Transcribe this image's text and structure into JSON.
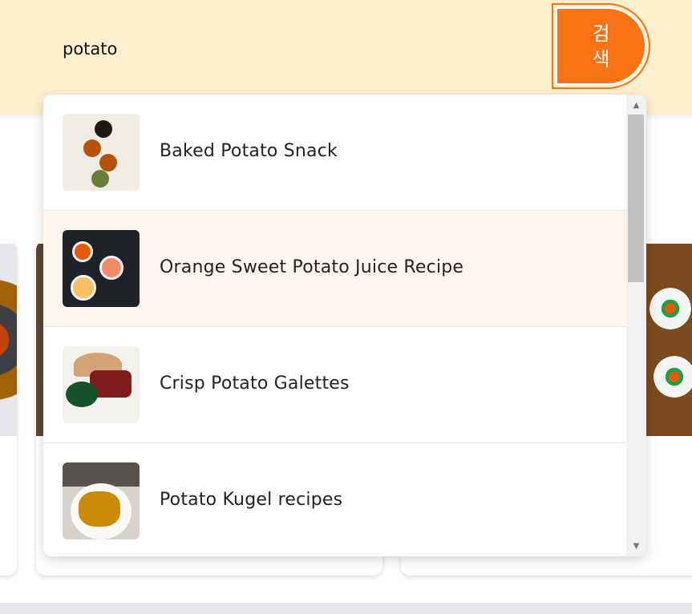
{
  "search": {
    "value": "potato",
    "button_label": "검색"
  },
  "dropdown": {
    "items": [
      {
        "label": "Baked Potato Snack"
      },
      {
        "label": "Orange Sweet Potato Juice Recipe"
      },
      {
        "label": "Crisp Potato Galettes"
      },
      {
        "label": "Potato Kugel recipes"
      }
    ],
    "highlighted_index": 1
  },
  "colors": {
    "accent": "#f97316",
    "header_bg": "#fef0cf",
    "hover_bg": "#fff6ed"
  }
}
